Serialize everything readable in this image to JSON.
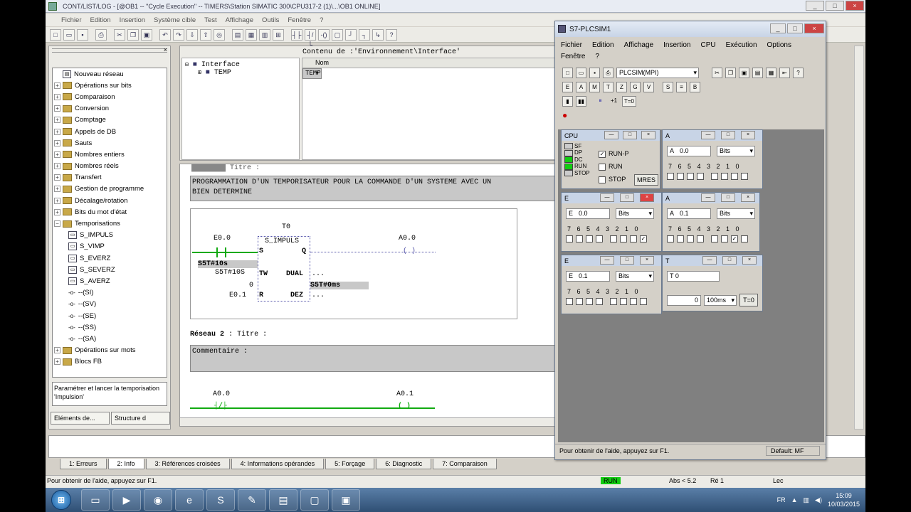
{
  "main": {
    "title": "CONT/LIST/LOG - [@OB1 -- \"Cycle Execution\" -- TIMERS\\Station SIMATIC 300\\CPU317-2 (1)\\...\\OB1  ONLINE]",
    "menu": [
      "Fichier",
      "Edition",
      "Insertion",
      "Système cible",
      "Test",
      "Affichage",
      "Outils",
      "Fenêtre",
      "?"
    ],
    "win_min": "_",
    "win_max": "□",
    "win_close": "×"
  },
  "tree": {
    "items": [
      {
        "label": "Nouveau réseau",
        "kind": "block"
      },
      {
        "label": "Opérations sur bits",
        "kind": "folder"
      },
      {
        "label": "Comparaison",
        "kind": "folder"
      },
      {
        "label": "Conversion",
        "kind": "folder"
      },
      {
        "label": "Comptage",
        "kind": "folder"
      },
      {
        "label": "Appels de DB",
        "kind": "folder"
      },
      {
        "label": "Sauts",
        "kind": "folder"
      },
      {
        "label": "Nombres entiers",
        "kind": "folder"
      },
      {
        "label": "Nombres réels",
        "kind": "folder"
      },
      {
        "label": "Transfert",
        "kind": "folder"
      },
      {
        "label": "Gestion de programme",
        "kind": "folder"
      },
      {
        "label": "Décalage/rotation",
        "kind": "folder"
      },
      {
        "label": "Bits du mot d'état",
        "kind": "folder"
      },
      {
        "label": "Temporisations",
        "kind": "folder"
      },
      {
        "label": "S_IMPULS",
        "kind": "sub"
      },
      {
        "label": "S_VIMP",
        "kind": "sub"
      },
      {
        "label": "S_EVERZ",
        "kind": "sub"
      },
      {
        "label": "S_SEVERZ",
        "kind": "sub"
      },
      {
        "label": "S_AVERZ",
        "kind": "sub"
      },
      {
        "label": "--(SI)",
        "kind": "coil"
      },
      {
        "label": "--(SV)",
        "kind": "coil"
      },
      {
        "label": "--(SE)",
        "kind": "coil"
      },
      {
        "label": "--(SS)",
        "kind": "coil"
      },
      {
        "label": "--(SA)",
        "kind": "coil"
      },
      {
        "label": "Opérations sur mots",
        "kind": "folder"
      },
      {
        "label": "Blocs FB",
        "kind": "folder"
      }
    ],
    "hint": "Paramétrer et lancer la temporisation 'Impulsion'",
    "tabs": [
      "Eléments de...",
      "Structure d"
    ]
  },
  "iface": {
    "content_label": "Contenu de :'Environnement\\Interface'",
    "tree_root": "Interface",
    "tree_child": "TEMP",
    "col_nom": "Nom",
    "row1": "TEMP"
  },
  "code": {
    "title_cut": "Titre :",
    "comment1_line1": "PROGRAMMATION D'UN TEMPORISATEUR POUR LA COMMANDE D'UN SYSTEME AVEC UN",
    "comment1_line2": "BIEN DETERMINE",
    "timer": "T0",
    "block": "S_IMPULS",
    "in_e00": "E0.0",
    "pin_s": "S",
    "pin_q": "Q",
    "out_a00": "A0.0",
    "s5t_val": "S5T#10s",
    "s5t_in": "S5T#10S",
    "pin_tw": "TW",
    "pin_dual": "DUAL",
    "dots": "...",
    "zero": "0",
    "s5t_out": "S5T#0ms",
    "in_e01": "E0.1",
    "pin_r": "R",
    "pin_dez": "DEZ",
    "net2_label": "Réseau",
    "net2_num": "2",
    "net2_title": ": Titre :",
    "comment2": "Commentaire :",
    "n2_in": "A0.0",
    "n2_out": "A0.1"
  },
  "bottom_tabs": [
    "1: Erreurs",
    "2: Info",
    "3: Références croisées",
    "4: Informations opérandes",
    "5: Forçage",
    "6: Diagnostic",
    "7: Comparaison"
  ],
  "status": {
    "help": "Pour obtenir de l'aide, appuyez sur F1.",
    "run": "RUN",
    "abs": "Abs < 5.2",
    "rel": "Ré 1",
    "lec": "Lec"
  },
  "sim": {
    "title": "S7-PLCSIM1",
    "menu": [
      "Fichier",
      "Edition",
      "Affichage",
      "Insertion",
      "CPU",
      "Exécution",
      "Options",
      "Fenêtre",
      "?"
    ],
    "target": "PLCSIM(MPI)",
    "status_help": "Pour obtenir de l'aide, appuyez sur F1.",
    "status_default": "Default:  MF",
    "cpu": {
      "title": "CPU",
      "leds": [
        "SF",
        "DP",
        "DC",
        "RUN",
        "STOP"
      ],
      "modes": [
        "RUN-P",
        "RUN",
        "STOP"
      ],
      "mres": "MRES"
    },
    "windows": [
      {
        "type": "A",
        "addr": "0.0",
        "fmt": "Bits",
        "checked": []
      },
      {
        "type": "E",
        "addr": "0.0",
        "fmt": "Bits",
        "checked": [
          0
        ]
      },
      {
        "type": "A",
        "addr": "0.1",
        "fmt": "Bits",
        "checked": [
          1
        ]
      },
      {
        "type": "E",
        "addr": "0.1",
        "fmt": "Bits",
        "checked": []
      }
    ],
    "bit_labels": "7 6 5 4   3 2 1 0",
    "timer": {
      "title": "T",
      "name": "T  0",
      "value": "0",
      "base": "100ms",
      "reset": "T=0"
    }
  },
  "taskbar": {
    "lang": "FR",
    "time": "15:09",
    "date": "10/03/2015"
  }
}
